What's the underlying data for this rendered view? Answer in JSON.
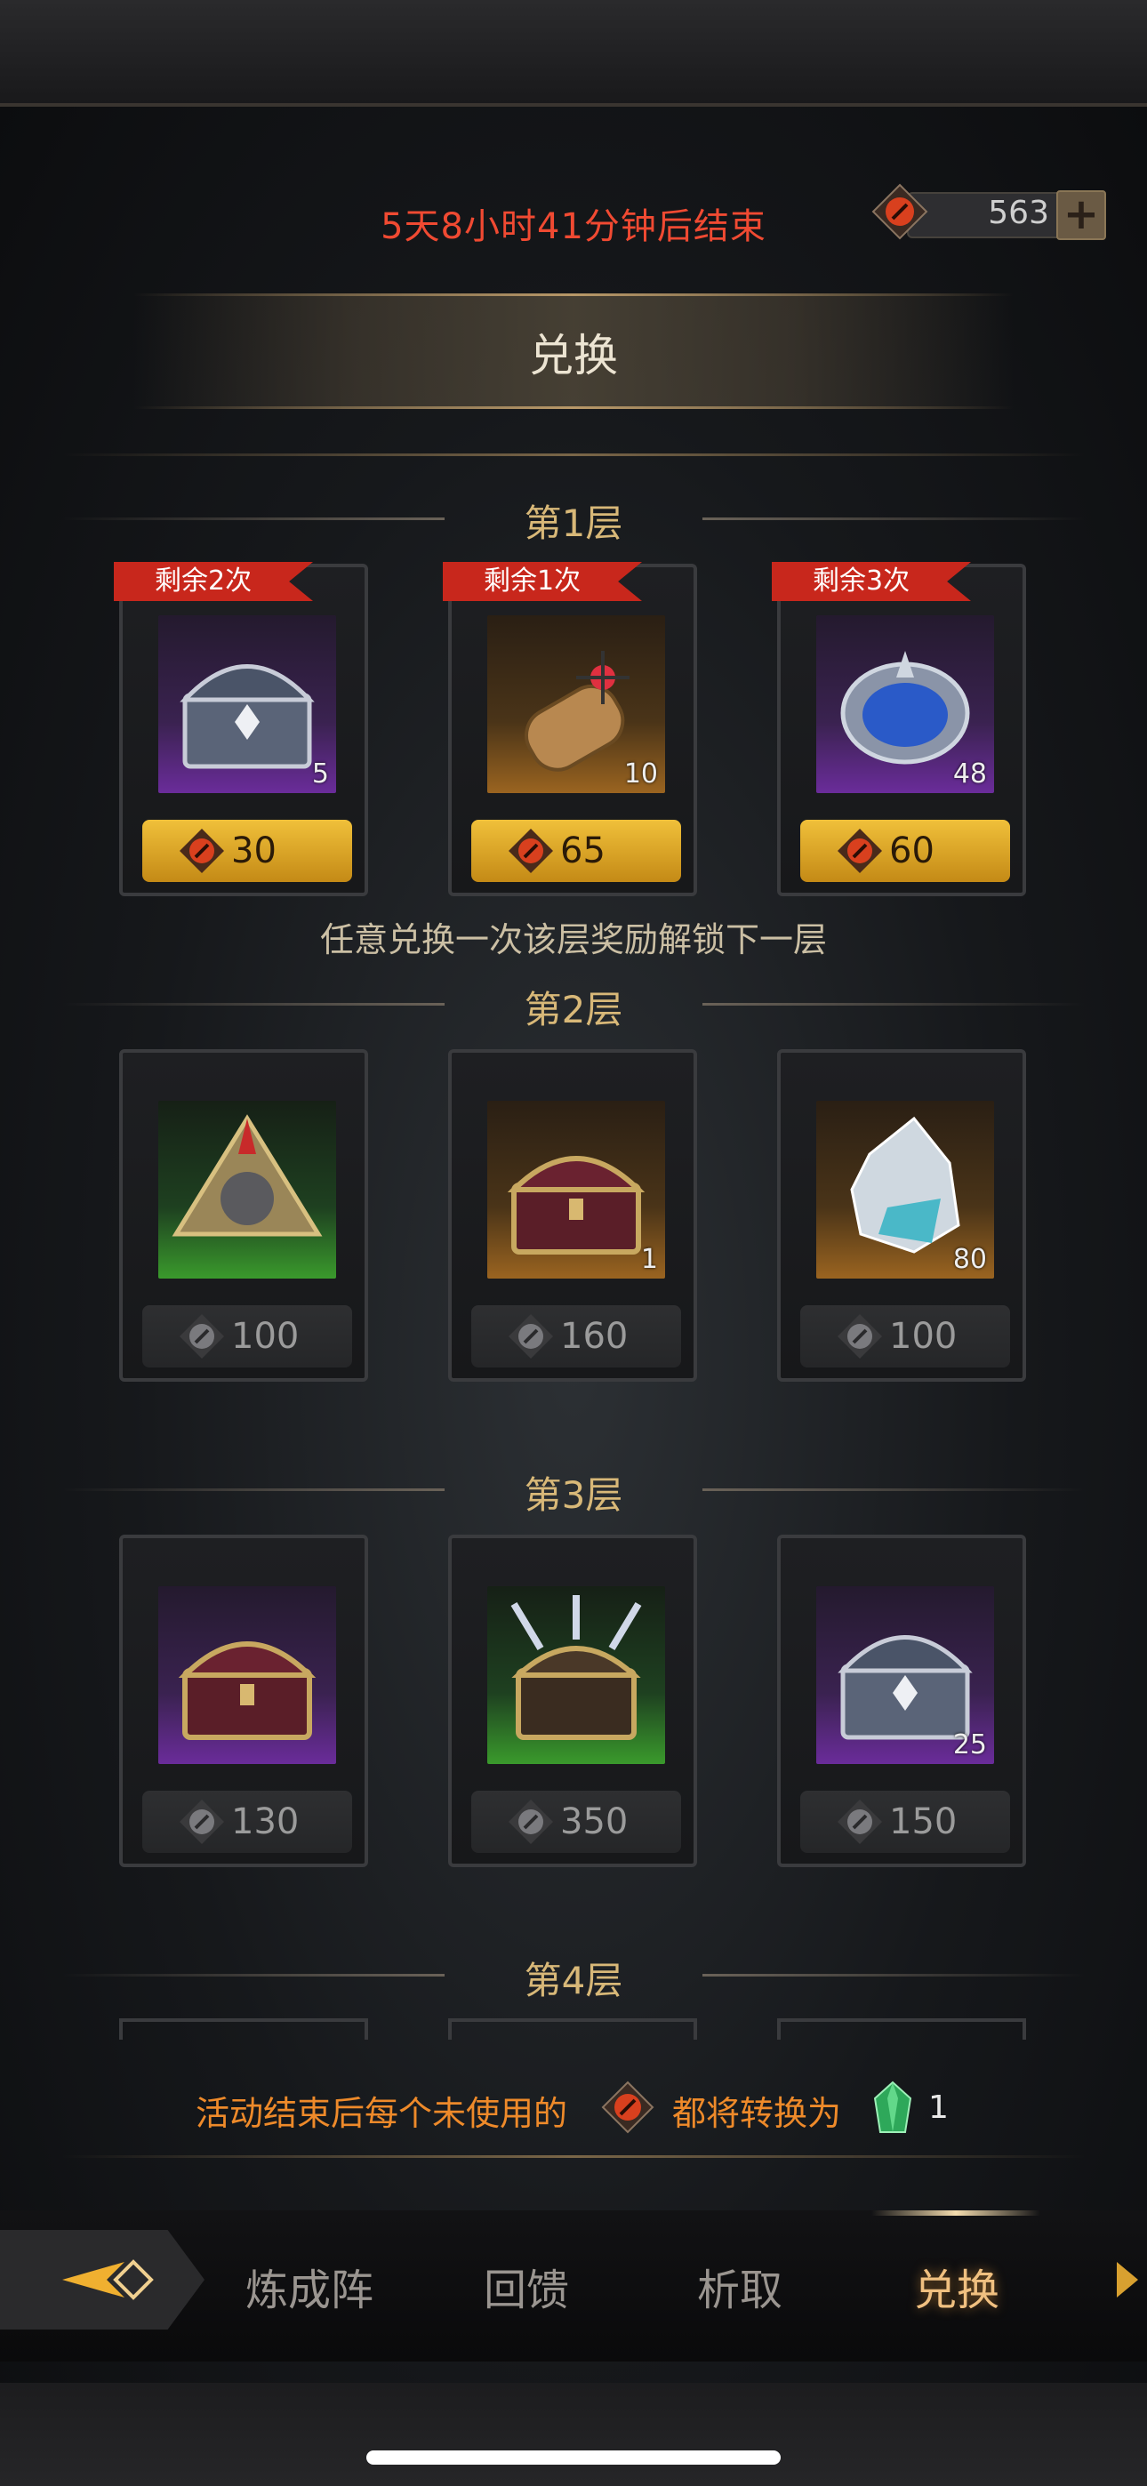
{
  "header": {
    "countdown": "5天8小时41分钟后结束",
    "currency_amount": "563",
    "currency_icon": "red-rune-gem-icon",
    "add_icon": "plus-icon"
  },
  "title": "兑换",
  "unlock_note": "任意兑换一次该层奖励解锁下一层",
  "tiers": [
    {
      "label": "第1层",
      "items": [
        {
          "remaining": "剩余2次",
          "qty": "5",
          "price": "30",
          "icon": "silver-chest-icon",
          "rarity_color": "#6a2c9a"
        },
        {
          "remaining": "剩余1次",
          "qty": "10",
          "price": "65",
          "icon": "scroll-icon",
          "rarity_color": "#9a6420"
        },
        {
          "remaining": "剩余3次",
          "qty": "48",
          "price": "60",
          "icon": "blue-crystal-icon",
          "rarity_color": "#6a2c9a"
        }
      ]
    },
    {
      "label": "第2层",
      "items": [
        {
          "qty": "",
          "price": "100",
          "icon": "pyramid-relic-icon",
          "rarity_color": "#3a9a2c"
        },
        {
          "qty": "1",
          "price": "160",
          "icon": "gold-chest-icon",
          "rarity_color": "#9a6420"
        },
        {
          "qty": "80",
          "price": "100",
          "icon": "ice-ore-icon",
          "rarity_color": "#9a6420"
        }
      ]
    },
    {
      "label": "第3层",
      "items": [
        {
          "qty": "",
          "price": "130",
          "icon": "gold-chest-icon",
          "rarity_color": "#6a2c9a"
        },
        {
          "qty": "",
          "price": "350",
          "icon": "spiked-chest-icon",
          "rarity_color": "#3a9a2c"
        },
        {
          "qty": "25",
          "price": "150",
          "icon": "silver-chest-icon",
          "rarity_color": "#6a2c9a"
        }
      ]
    },
    {
      "label": "第4层",
      "items": []
    }
  ],
  "footer_note": {
    "text_before": "活动结束后每个未使用的",
    "text_after": "都将转换为",
    "converted_amount": "1",
    "from_icon": "red-rune-gem-icon",
    "to_icon": "emerald-icon"
  },
  "nav": {
    "back_icon": "back-arrow-icon",
    "tabs": [
      "炼成阵",
      "回馈",
      "析取",
      "兑换"
    ],
    "active_tab": "兑换",
    "next_icon": "chevron-right-icon"
  },
  "colors": {
    "countdown": "#f04a32",
    "tier_label": "#d8b878",
    "footer_note": "#ee8a2a",
    "ribbon": "#c8271c",
    "gold_price": "#f0c03a",
    "active_tab": "#f0c080"
  }
}
